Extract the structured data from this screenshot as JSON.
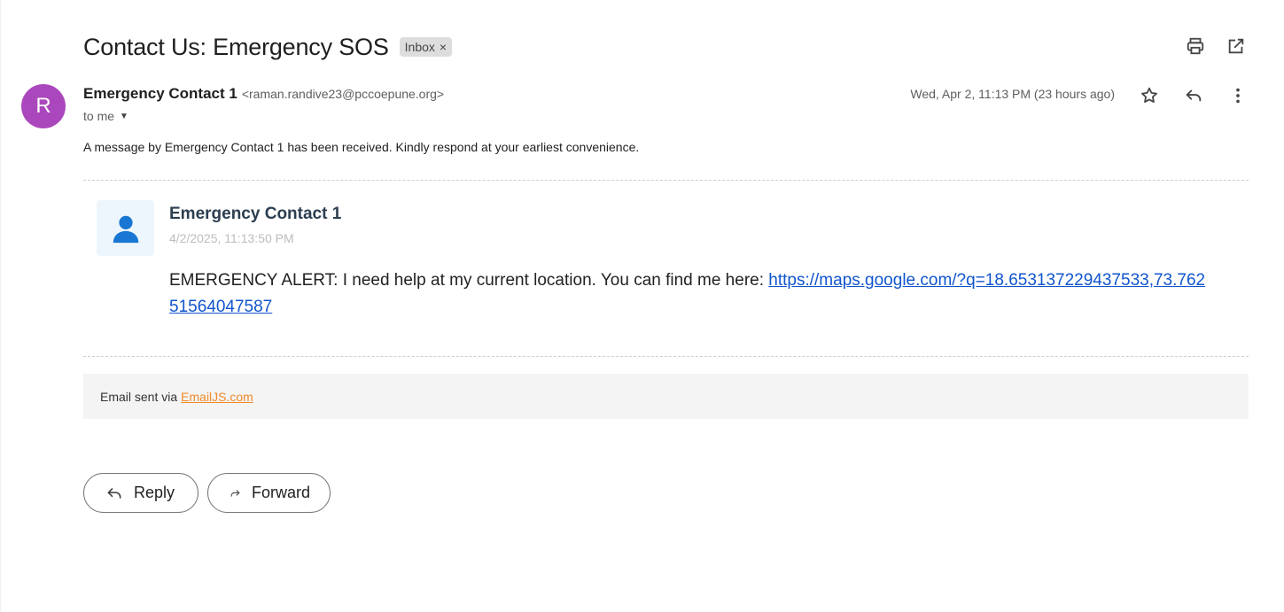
{
  "email": {
    "subject": "Contact Us: Emergency SOS",
    "label": "Inbox",
    "label_close": "×",
    "sender": {
      "avatar_letter": "R",
      "avatar_color": "#ab47bc",
      "name": "Emergency Contact 1",
      "email": "<raman.randive23@pccoepune.org>"
    },
    "to": "to me",
    "date": "Wed, Apr 2, 11:13 PM (23 hours ago)",
    "preview": "A message by Emergency Contact 1 has been received. Kindly respond at your earliest convenience."
  },
  "message_card": {
    "icon": "person-icon",
    "name": "Emergency Contact 1",
    "timestamp": "4/2/2025, 11:13:50 PM",
    "text": "EMERGENCY ALERT: I need help at my current location. You can find me here: ",
    "link": "https://maps.google.com/?q=18.653137229437533,73.76251564047587"
  },
  "footer": {
    "prefix": "Email sent via",
    "link": "EmailJS.com",
    "link_color": "#f08a2b"
  },
  "actions": {
    "reply": "Reply",
    "forward": "Forward"
  },
  "icons": {
    "print": "print-icon",
    "open_new": "open-in-new-icon",
    "star": "star-icon",
    "reply": "reply-icon",
    "more": "more-vert-icon"
  }
}
